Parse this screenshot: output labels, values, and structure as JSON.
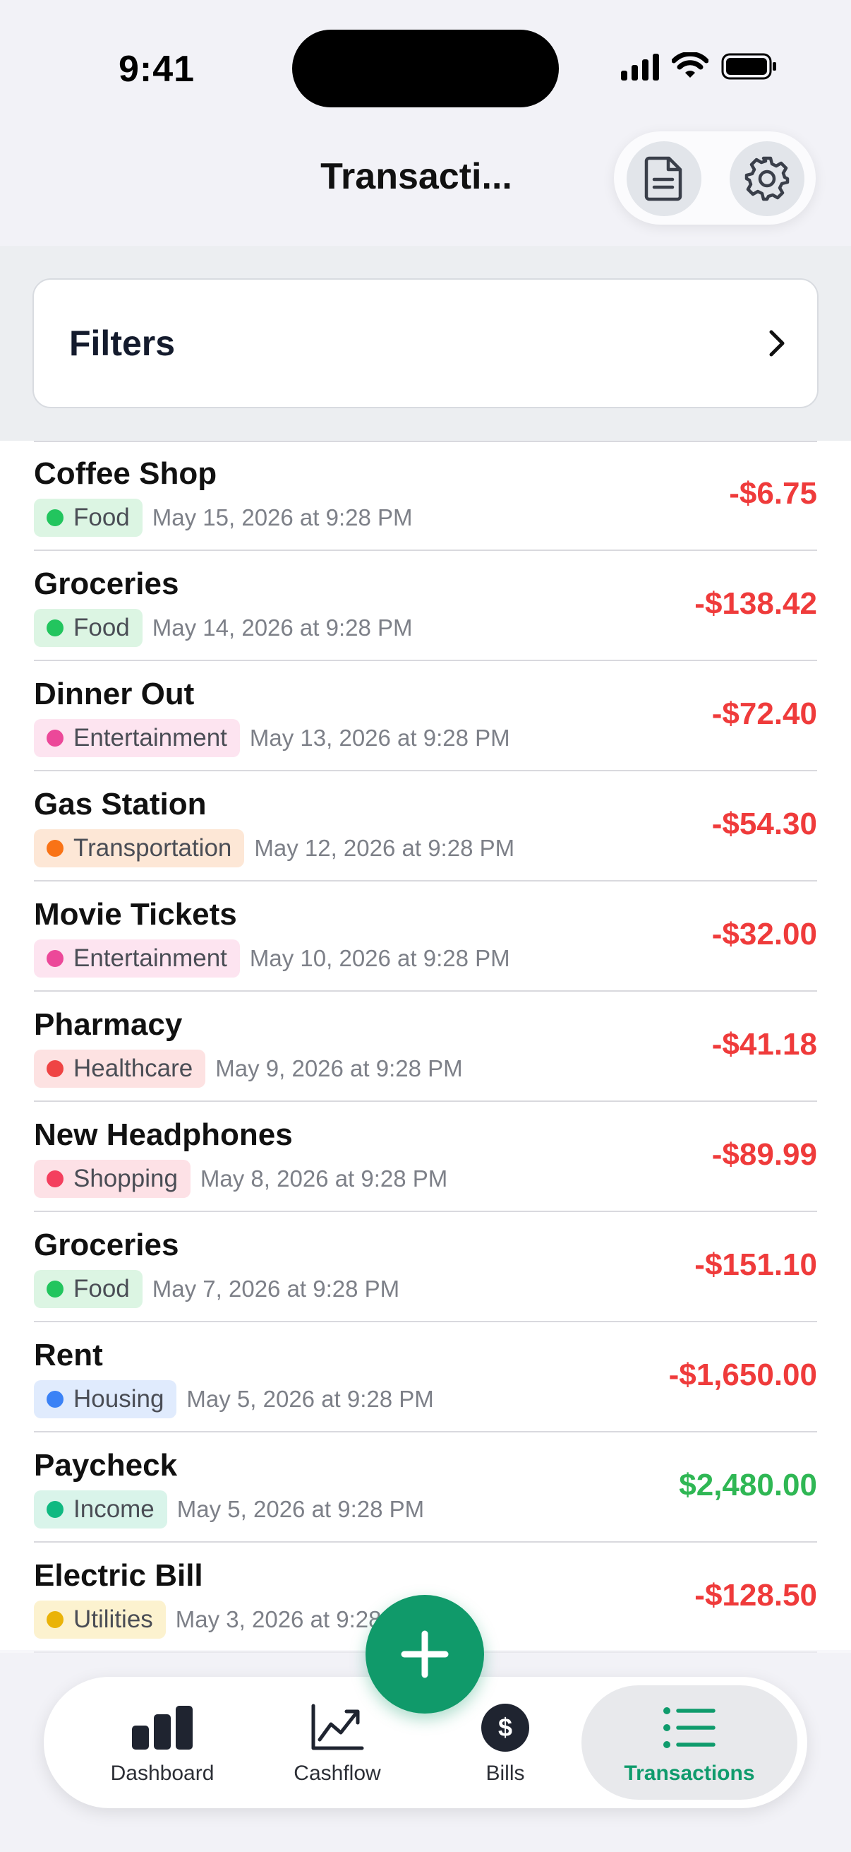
{
  "status_bar": {
    "time": "9:41"
  },
  "header": {
    "title": "Transacti..."
  },
  "filters": {
    "label": "Filters"
  },
  "transactions": [
    {
      "title": "Coffee Shop",
      "category": "Food",
      "date": "May 15, 2026 at 9:28 PM",
      "amount": "-$6.75"
    },
    {
      "title": "Groceries",
      "category": "Food",
      "date": "May 14, 2026 at 9:28 PM",
      "amount": "-$138.42"
    },
    {
      "title": "Dinner Out",
      "category": "Entertainment",
      "date": "May 13, 2026 at 9:28 PM",
      "amount": "-$72.40"
    },
    {
      "title": "Gas Station",
      "category": "Transportation",
      "date": "May 12, 2026 at 9:28 PM",
      "amount": "-$54.30"
    },
    {
      "title": "Movie Tickets",
      "category": "Entertainment",
      "date": "May 10, 2026 at 9:28 PM",
      "amount": "-$32.00"
    },
    {
      "title": "Pharmacy",
      "category": "Healthcare",
      "date": "May 9, 2026 at 9:28 PM",
      "amount": "-$41.18"
    },
    {
      "title": "New Headphones",
      "category": "Shopping",
      "date": "May 8, 2026 at 9:28 PM",
      "amount": "-$89.99"
    },
    {
      "title": "Groceries",
      "category": "Food",
      "date": "May 7, 2026 at 9:28 PM",
      "amount": "-$151.10"
    },
    {
      "title": "Rent",
      "category": "Housing",
      "date": "May 5, 2026 at 9:28 PM",
      "amount": "-$1,650.00"
    },
    {
      "title": "Paycheck",
      "category": "Income",
      "date": "May 5, 2026 at 9:28 PM",
      "amount": "$2,480.00"
    },
    {
      "title": "Electric Bill",
      "category": "Utilities",
      "date": "May 3, 2026 at 9:28 PM",
      "amount": "-$128.50"
    }
  ],
  "category_colors": {
    "Food": {
      "dot": "#22c55e",
      "bg": "#dcf5e3"
    },
    "Entertainment": {
      "dot": "#ec4899",
      "bg": "#fde4f0"
    },
    "Transportation": {
      "dot": "#f97316",
      "bg": "#fde7d6"
    },
    "Healthcare": {
      "dot": "#ef4444",
      "bg": "#fde2e2"
    },
    "Shopping": {
      "dot": "#f43f5e",
      "bg": "#fde1e6"
    },
    "Housing": {
      "dot": "#3b82f6",
      "bg": "#e0ebfd"
    },
    "Income": {
      "dot": "#10b981",
      "bg": "#d9f4ea"
    },
    "Utilities": {
      "dot": "#eab308",
      "bg": "#fcf2cf"
    }
  },
  "amount_colors": {
    "negative": "#ef3b3b",
    "positive": "#2fb754"
  },
  "tabs": [
    {
      "label": "Dashboard",
      "icon": "bar-chart-icon"
    },
    {
      "label": "Cashflow",
      "icon": "trend-chart-icon"
    },
    {
      "label": "Bills",
      "icon": "dollar-circle-icon"
    },
    {
      "label": "Transactions",
      "icon": "list-icon",
      "active": true
    }
  ],
  "accent_color": "#109a6a"
}
